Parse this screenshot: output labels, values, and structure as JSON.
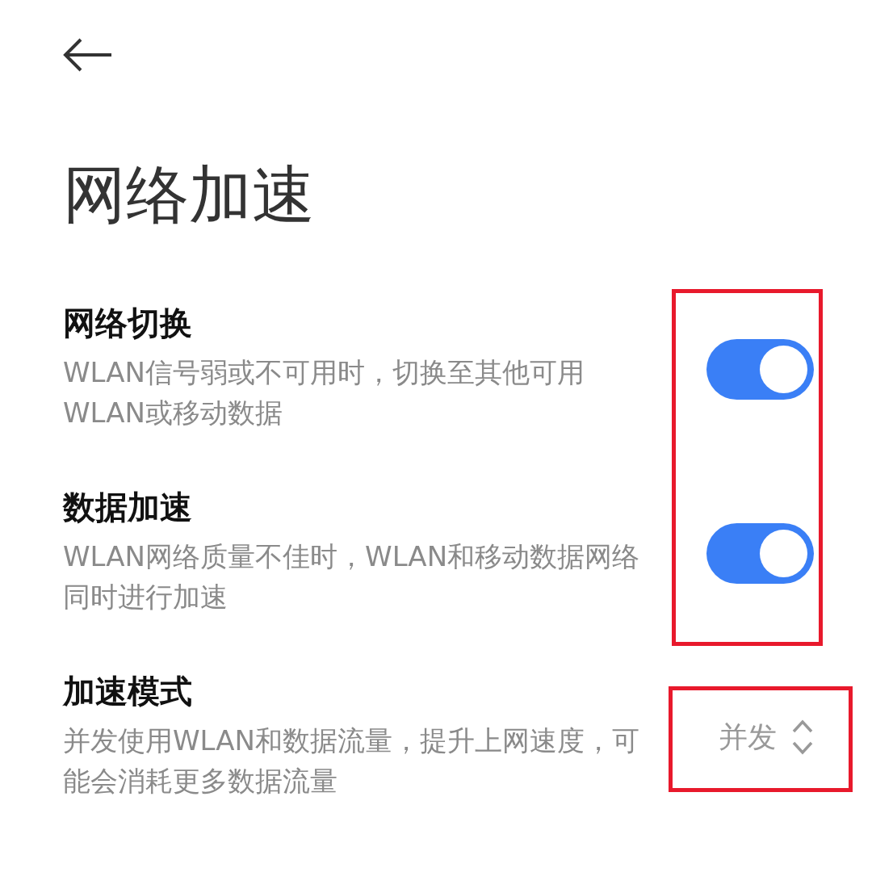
{
  "title": "网络加速",
  "settings": [
    {
      "kind": "toggle",
      "label": "网络切换",
      "description": "WLAN信号弱或不可用时，切换至其他可用WLAN或移动数据",
      "on": true,
      "highlighted": true
    },
    {
      "kind": "toggle",
      "label": "数据加速",
      "description": "WLAN网络质量不佳时，WLAN和移动数据网络同时进行加速",
      "on": true,
      "highlighted": true
    },
    {
      "kind": "select",
      "label": "加速模式",
      "description": "并发使用WLAN和数据流量，提升上网速度，可能会消耗更多数据流量",
      "value": "并发",
      "highlighted": true
    }
  ]
}
